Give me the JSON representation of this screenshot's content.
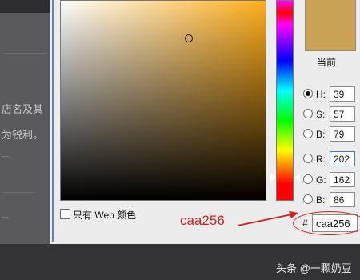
{
  "background": {
    "text_lines": [
      "店名及其",
      "为锐利。",
      "— ",
      "— "
    ]
  },
  "dialog": {
    "field_color": "#ffad1a",
    "new_color_label": "当前",
    "new_color": "#caa256",
    "fields": [
      {
        "key": "H",
        "label": "H:",
        "value": "39",
        "checked": true
      },
      {
        "key": "S",
        "label": "S:",
        "value": "57",
        "checked": false
      },
      {
        "key": "B",
        "label": "B:",
        "value": "79",
        "checked": false
      },
      {
        "key": "R",
        "label": "R:",
        "value": "202",
        "checked": false
      },
      {
        "key": "G",
        "label": "G:",
        "value": "162",
        "checked": false
      },
      {
        "key": "Bb",
        "label": "B:",
        "value": "86",
        "checked": false
      }
    ],
    "hex_prefix": "#",
    "hex_value": "caa256",
    "web_only_label": "只有 Web 颜色"
  },
  "annotation": {
    "text": "caa256",
    "color": "#d21f1f"
  },
  "watermark": "头条 @一颗奶豆"
}
